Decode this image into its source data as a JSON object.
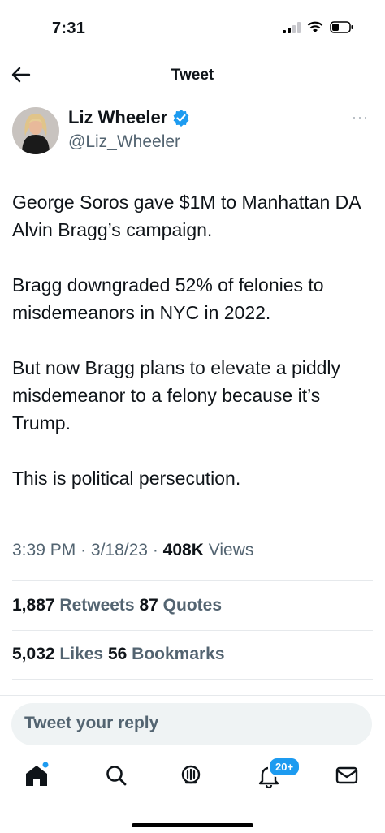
{
  "status_bar": {
    "time": "7:31"
  },
  "header": {
    "title": "Tweet"
  },
  "author": {
    "name": "Liz Wheeler",
    "handle": "@Liz_Wheeler"
  },
  "more_label": "···",
  "tweet": {
    "paragraphs": [
      "George Soros gave $1M to Manhattan DA Alvin Bragg’s campaign.",
      "Bragg downgraded 52% of felonies to misdemeanors in NYC in 2022.",
      "But now Bragg plans to elevate a piddly misdemeanor to a felony because it’s Trump.",
      "This is political persecution."
    ]
  },
  "meta": {
    "time": "3:39 PM",
    "date": "3/18/23",
    "views_count": "408K",
    "views_label": "Views",
    "separator": "·"
  },
  "stats": {
    "retweets_count": "1,887",
    "retweets_label": "Retweets",
    "quotes_count": "87",
    "quotes_label": "Quotes",
    "likes_count": "5,032",
    "likes_label": "Likes",
    "bookmarks_count": "56",
    "bookmarks_label": "Bookmarks"
  },
  "reply": {
    "placeholder": "Tweet your reply"
  },
  "tabbar": {
    "icons": [
      "home-icon",
      "search-icon",
      "spaces-icon",
      "notifications-icon",
      "messages-icon"
    ],
    "notifications_badge": "20+"
  },
  "colors": {
    "accent": "#1d9bf0",
    "secondary_text": "#536471",
    "verified": "#1d9bf0"
  }
}
